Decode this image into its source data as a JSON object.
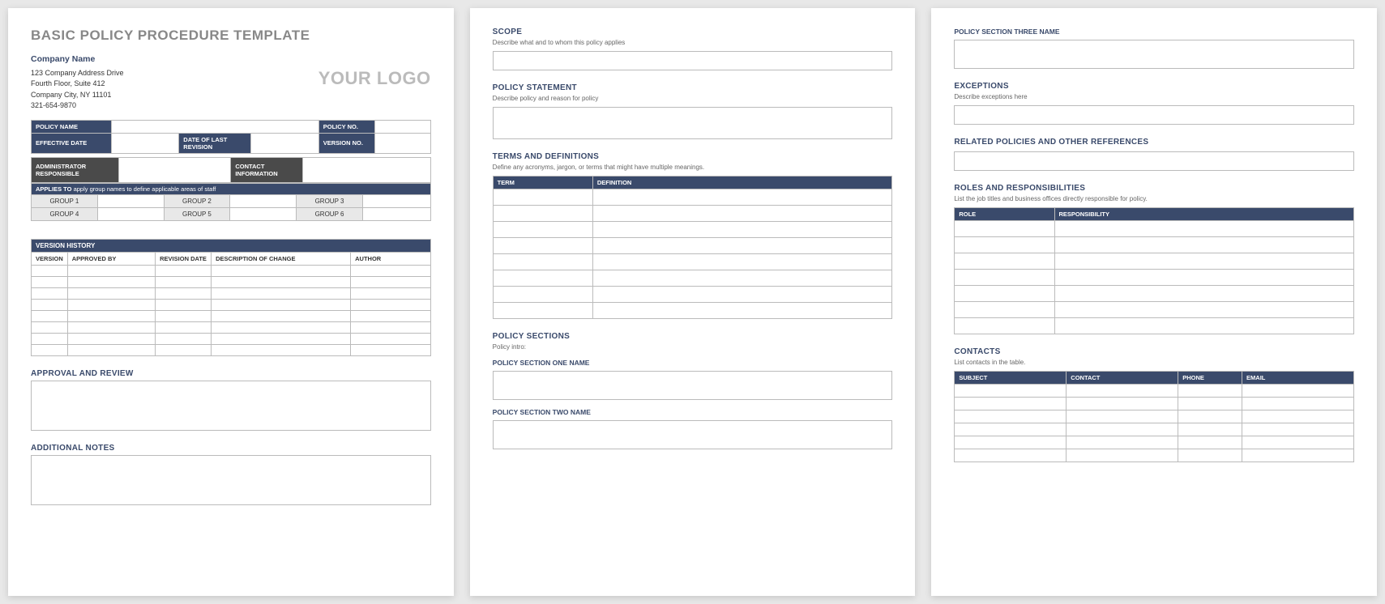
{
  "page1": {
    "title": "BASIC POLICY PROCEDURE TEMPLATE",
    "company": {
      "name": "Company Name",
      "addr1": "123 Company Address Drive",
      "addr2": "Fourth Floor, Suite 412",
      "addr3": "Company City, NY  11101",
      "phone": "321-654-9870"
    },
    "logo": "YOUR LOGO",
    "meta": {
      "policy_name": "POLICY NAME",
      "policy_no": "POLICY NO.",
      "effective_date": "EFFECTIVE DATE",
      "date_last_revision": "DATE OF LAST REVISION",
      "version_no": "VERSION NO.",
      "admin_responsible": "ADMINISTRATOR RESPONSIBLE",
      "contact_info": "CONTACT INFORMATION"
    },
    "applies_to": {
      "label": "APPLIES TO",
      "desc": "apply group names to define applicable areas of staff",
      "groups": [
        "GROUP 1",
        "GROUP 2",
        "GROUP 3",
        "GROUP 4",
        "GROUP 5",
        "GROUP 6"
      ]
    },
    "version_history": {
      "heading": "VERSION HISTORY",
      "cols": [
        "VERSION",
        "APPROVED BY",
        "REVISION DATE",
        "DESCRIPTION OF CHANGE",
        "AUTHOR"
      ]
    },
    "approval_review": "APPROVAL AND REVIEW",
    "additional_notes": "ADDITIONAL NOTES"
  },
  "page2": {
    "scope": {
      "heading": "SCOPE",
      "desc": "Describe what and to whom this policy applies"
    },
    "policy_statement": {
      "heading": "POLICY STATEMENT",
      "desc": "Describe policy and reason for policy"
    },
    "terms": {
      "heading": "TERMS AND DEFINITIONS",
      "desc": "Define any acronyms, jargon, or terms that might have multiple meanings.",
      "cols": [
        "TERM",
        "DEFINITION"
      ]
    },
    "policy_sections": {
      "heading": "POLICY SECTIONS",
      "intro": "Policy intro:",
      "s1": "POLICY SECTION ONE NAME",
      "s2": "POLICY SECTION TWO NAME"
    }
  },
  "page3": {
    "s3": "POLICY SECTION THREE NAME",
    "exceptions": {
      "heading": "EXCEPTIONS",
      "desc": "Describe exceptions here"
    },
    "related": "RELATED POLICIES AND OTHER REFERENCES",
    "roles": {
      "heading": "ROLES AND RESPONSIBILITIES",
      "desc": "List the job titles and business offices directly responsible for policy.",
      "cols": [
        "ROLE",
        "RESPONSIBILITY"
      ]
    },
    "contacts": {
      "heading": "CONTACTS",
      "desc": "List contacts in the table.",
      "cols": [
        "SUBJECT",
        "CONTACT",
        "PHONE",
        "EMAIL"
      ]
    }
  }
}
